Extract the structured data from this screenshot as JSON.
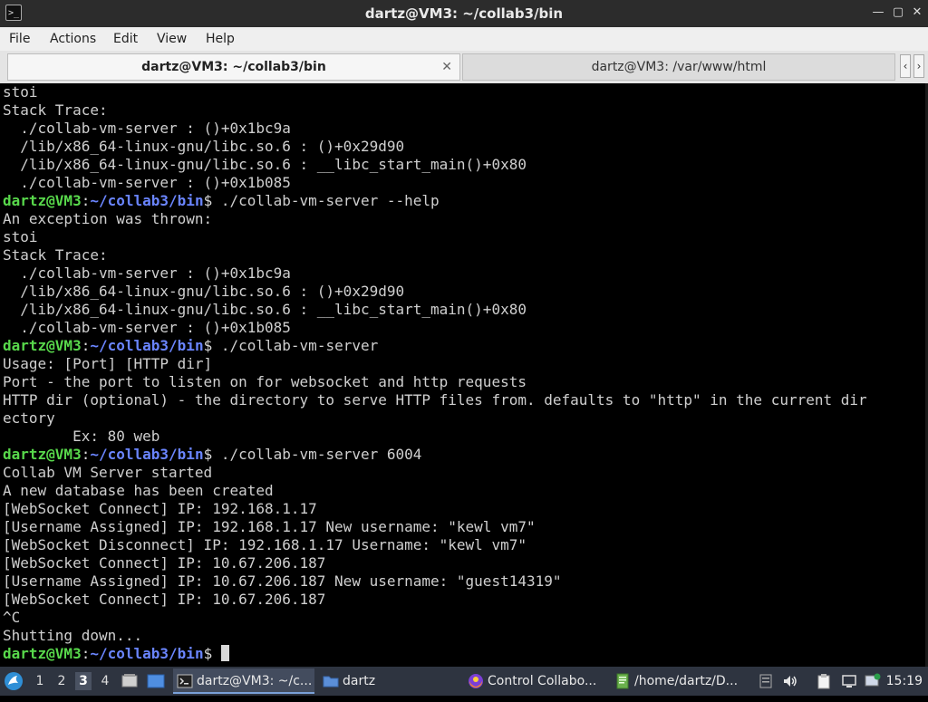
{
  "window": {
    "title": "dartz@VM3: ~/collab3/bin"
  },
  "menu": [
    "File",
    "Actions",
    "Edit",
    "View",
    "Help"
  ],
  "tabs": [
    {
      "label": "dartz@VM3: ~/collab3/bin",
      "active": true
    },
    {
      "label": "dartz@VM3: /var/www/html",
      "active": false
    }
  ],
  "prompt": {
    "user": "dartz@VM3",
    "sep": ":",
    "path": "~/collab3/bin",
    "dollar": "$"
  },
  "terminal_lines": [
    {
      "text": "stoi"
    },
    {
      "text": "Stack Trace:"
    },
    {
      "text": "  ./collab-vm-server : ()+0x1bc9a"
    },
    {
      "text": "  /lib/x86_64-linux-gnu/libc.so.6 : ()+0x29d90"
    },
    {
      "text": "  /lib/x86_64-linux-gnu/libc.so.6 : __libc_start_main()+0x80"
    },
    {
      "text": "  ./collab-vm-server : ()+0x1b085"
    },
    {
      "prompt": true,
      "cmd": " ./collab-vm-server --help"
    },
    {
      "text": "An exception was thrown:"
    },
    {
      "text": "stoi"
    },
    {
      "text": "Stack Trace:"
    },
    {
      "text": "  ./collab-vm-server : ()+0x1bc9a"
    },
    {
      "text": "  /lib/x86_64-linux-gnu/libc.so.6 : ()+0x29d90"
    },
    {
      "text": "  /lib/x86_64-linux-gnu/libc.so.6 : __libc_start_main()+0x80"
    },
    {
      "text": "  ./collab-vm-server : ()+0x1b085"
    },
    {
      "prompt": true,
      "cmd": " ./collab-vm-server"
    },
    {
      "text": "Usage: [Port] [HTTP dir]"
    },
    {
      "text": "Port - the port to listen on for websocket and http requests"
    },
    {
      "text": "HTTP dir (optional) - the directory to serve HTTP files from. defaults to \"http\" in the current dir"
    },
    {
      "text": "ectory"
    },
    {
      "text": "        Ex: 80 web"
    },
    {
      "prompt": true,
      "cmd": " ./collab-vm-server 6004"
    },
    {
      "text": "Collab VM Server started"
    },
    {
      "text": "A new database has been created"
    },
    {
      "text": "[WebSocket Connect] IP: 192.168.1.17"
    },
    {
      "text": "[Username Assigned] IP: 192.168.1.17 New username: \"kewl vm7\""
    },
    {
      "text": "[WebSocket Disconnect] IP: 192.168.1.17 Username: \"kewl vm7\""
    },
    {
      "text": "[WebSocket Connect] IP: 10.67.206.187"
    },
    {
      "text": "[Username Assigned] IP: 10.67.206.187 New username: \"guest14319\""
    },
    {
      "text": "[WebSocket Connect] IP: 10.67.206.187"
    },
    {
      "text": "^C"
    },
    {
      "text": "Shutting down..."
    },
    {
      "prompt": true,
      "cmd": " ",
      "cursor": true
    }
  ],
  "taskbar": {
    "workspaces": [
      "1",
      "2",
      "3",
      "4"
    ],
    "current_workspace": "3",
    "tasks": [
      {
        "label": "dartz@VM3: ~/c...",
        "icon": "terminal-icon",
        "active": true
      },
      {
        "label": "dartz",
        "icon": "folder-icon",
        "active": false
      },
      {
        "label": "Control Collabo...",
        "icon": "firefox-icon",
        "active": false
      },
      {
        "label": "/home/dartz/D...",
        "icon": "text-editor-icon",
        "active": false
      }
    ],
    "clock": "15:19"
  },
  "colors": {
    "prompt_user": "#58d84b",
    "prompt_path": "#6a85ff",
    "terminal_bg": "#000000",
    "terminal_fg": "#cfcfcf",
    "taskbar_bg": "#2e3440"
  }
}
